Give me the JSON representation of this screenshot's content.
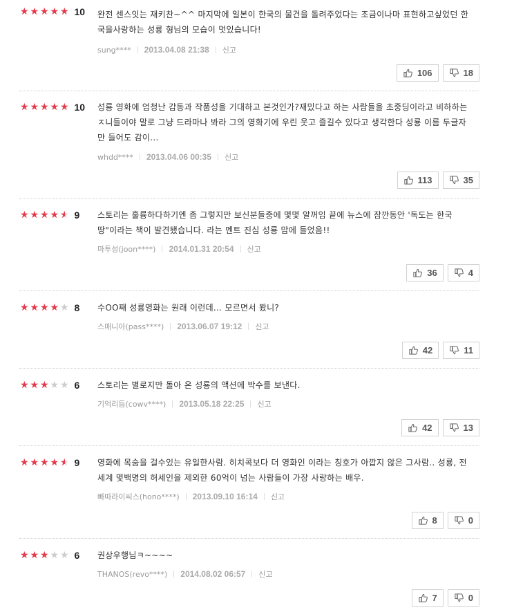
{
  "colors": {
    "star_on": "#e8394a",
    "star_off": "#cccccc"
  },
  "labels": {
    "report": "신고"
  },
  "reviews": [
    {
      "stars": 5,
      "score": "10",
      "body": "완전 센스잇는 재키찬~^^ 마지막에 일본이 한국의 물건을 돌려주었다는 조금이나마 표현하고싶었던 한국을사랑하는 성룡 형님의 모습이 멋있습니다!",
      "author": "sung****",
      "date": "2013.04.08 21:38",
      "likes": "106",
      "dislikes": "18"
    },
    {
      "stars": 5,
      "score": "10",
      "body": "성룡 영화에 엄청난 감동과 작품성을 기대하고 본것인가?재밌다고 하는 사람들을 초중딩이라고 비하하는ㅈ니들이야 말로 그냥 드라마나 봐라 그의 영화기에 우린 웃고 즐길수 있다고 생각한다 성룡 이름 두글자만 들어도 감이...",
      "author": "whdd****",
      "date": "2013.04.06 00:35",
      "likes": "113",
      "dislikes": "35"
    },
    {
      "stars": 4.5,
      "score": "9",
      "body": "스토리는 훌륭하다하기엔 좀 그렇지만 보신분들중에 몇몇 알꺼임 끝에 뉴스에 잠깐동안 '독도는 한국땅\"이라는 책이 발견됐습니다. 라는 멘트 진심 성룡 맘에 들었음!!",
      "author": "마투성(joon****)",
      "date": "2014.01.31 20:54",
      "likes": "36",
      "dislikes": "4"
    },
    {
      "stars": 4,
      "score": "8",
      "body": "수OO째 성룡영화는 원래 이런데... 모르면서 봤니?",
      "author": "스매니아(pass****)",
      "date": "2013.06.07 19:12",
      "likes": "42",
      "dislikes": "11"
    },
    {
      "stars": 3,
      "score": "6",
      "body": "스토리는 별로지만 돌아 온 성룡의 액션에 박수를 보낸다.",
      "author": "기억리듬(cowv****)",
      "date": "2013.05.18 22:25",
      "likes": "42",
      "dislikes": "13"
    },
    {
      "stars": 4.5,
      "score": "9",
      "body": "영화에 목숨을 걸수있는 유일한사람. 히치콕보다 더 영화인 이라는 칭호가 아깝지 않은 그사람.. 성룡, 전세계 몇백명의 허세인을 제외한 60억이 넘는 사람들이 가장 사랑하는 배우.",
      "author": "빠따라이씨스(hono****)",
      "date": "2013.09.10 16:14",
      "likes": "8",
      "dislikes": "0"
    },
    {
      "stars": 3,
      "score": "6",
      "body": "권상우행님ㅋ~~~~",
      "author": "THANOS(revo****)",
      "date": "2014.08.02 06:57",
      "likes": "7",
      "dislikes": "0"
    }
  ]
}
